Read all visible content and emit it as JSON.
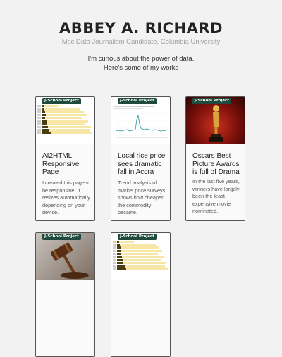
{
  "header": {
    "name": "ABBEY A. RICHARD",
    "subtitle": "Msc Data Journalism Candidate, Columbia University",
    "intro_line1": "I'm curious about the power of data.",
    "intro_line2": "Here's some of my works"
  },
  "colors": {
    "tag_bg": "#1f4a3d",
    "bar_light": "#f6e7a6",
    "bar_dark": "#4a3d10",
    "line_color": "#3aa0a4"
  },
  "cards": [
    {
      "tag": "J-School Project",
      "title": "AI2HTML Responsive Page",
      "desc": "I created this page to be responsive. It resizes automatically depending on your device.",
      "thumbnail": "bar-chart"
    },
    {
      "tag": "J-School Project",
      "title": "Local rice price sees dramatic fall in Accra",
      "desc": "Trend analysis of market price surveys shows how cheaper the commodity became.",
      "thumbnail": "line-chart"
    },
    {
      "tag": "J-School Project",
      "title": "Oscars Best Picture Awards is full of Drama",
      "desc": "In the last five years, winners have largely been the least expensive movie nominated.",
      "thumbnail": "oscar-statue-image"
    },
    {
      "tag": "J-School Project",
      "title": "",
      "desc": "",
      "thumbnail": "gavel-image"
    },
    {
      "tag": "J-School Project",
      "title": "",
      "desc": "",
      "thumbnail": "bar-chart"
    }
  ]
}
